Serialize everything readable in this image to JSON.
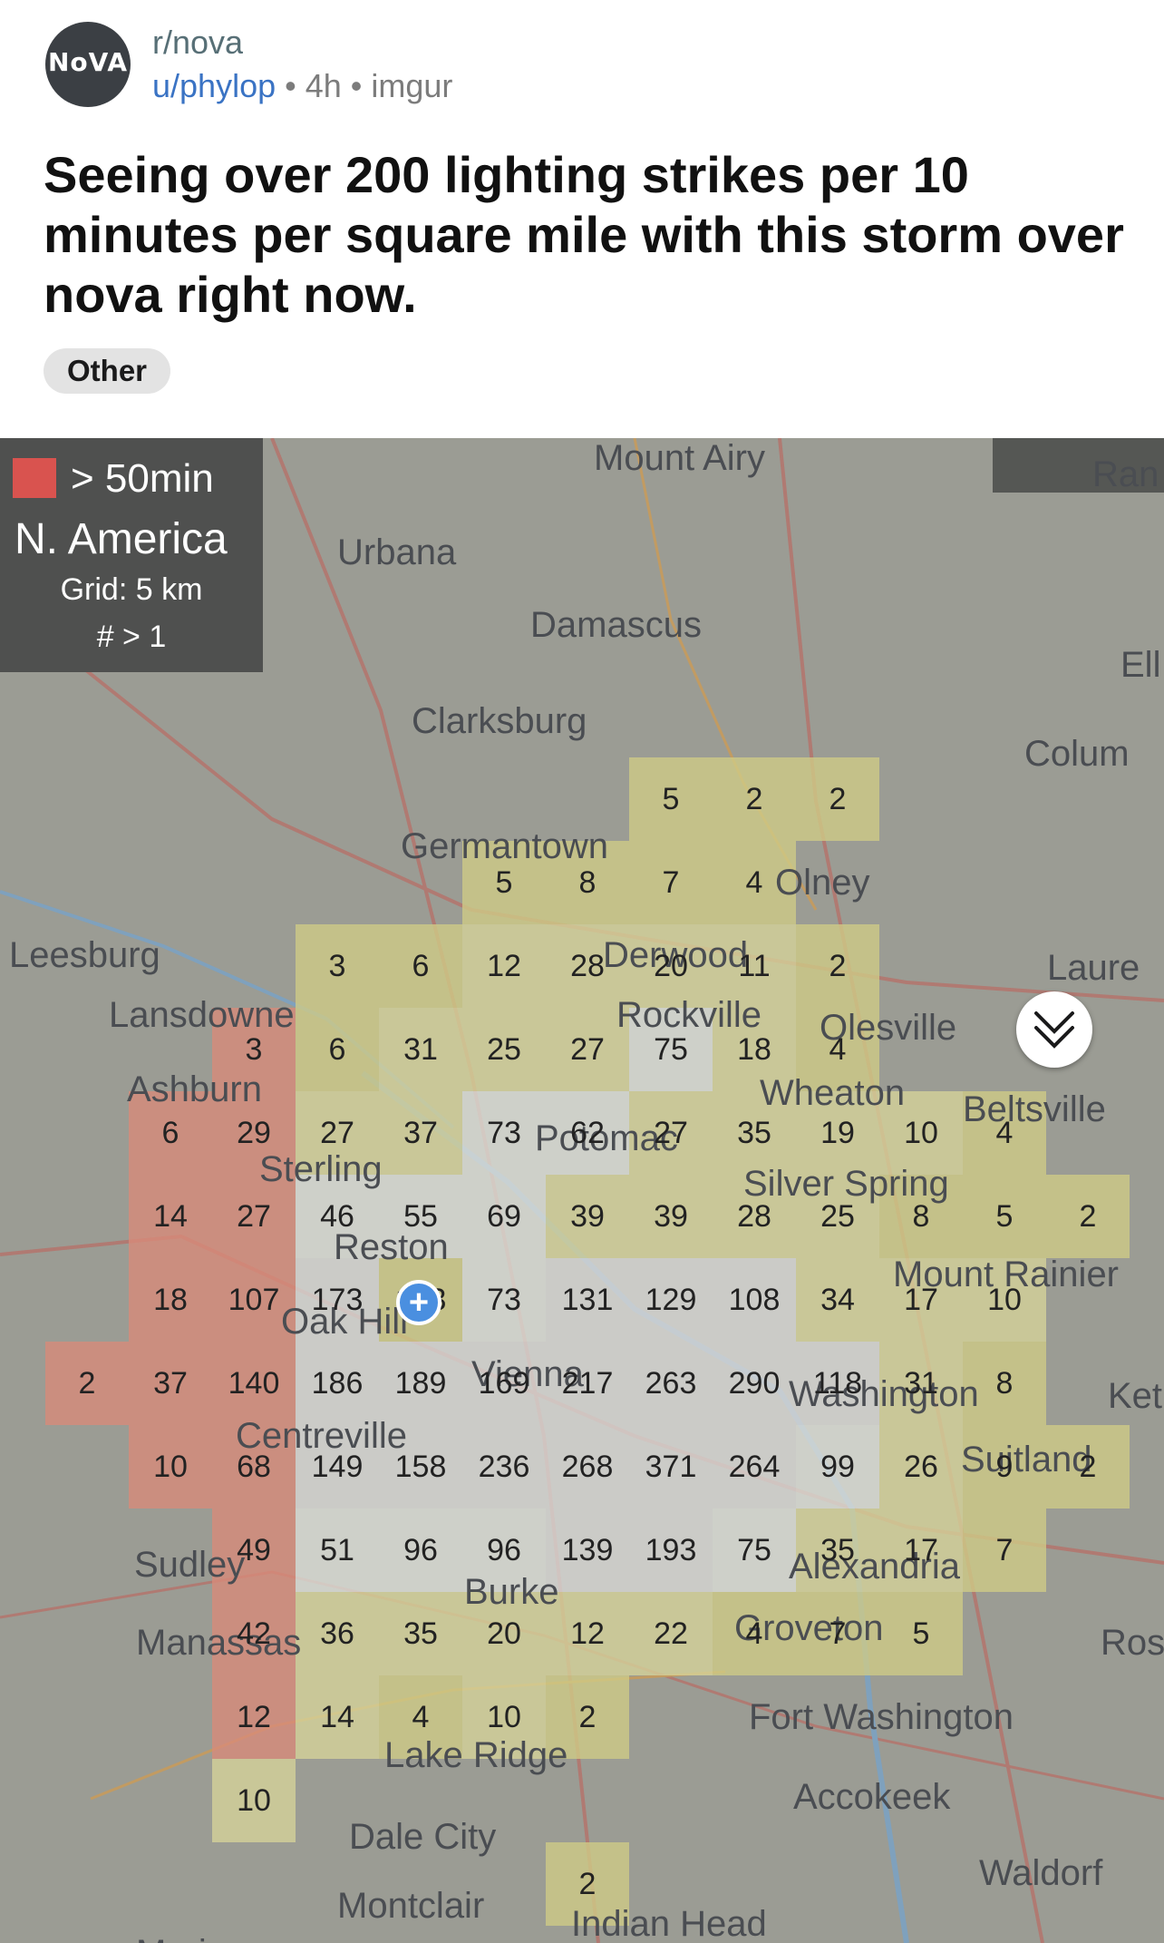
{
  "post": {
    "avatar_text": "NoVA",
    "subreddit": "r/nova",
    "user": "u/phylop",
    "age": "4h",
    "source": "imgur",
    "separator": "•",
    "title": "Seeing over 200 lighting strikes per 10 minutes per square mile with this storm over nova right now.",
    "flair": "Other"
  },
  "map": {
    "legend": {
      "swatch_color": "#d9534f",
      "label": "> 50min",
      "region": "N. America",
      "grid": "Grid: 5 km",
      "threshold": "# > 1"
    },
    "places": [
      "Mount Airy",
      "Ran",
      "Urbana",
      "Damascus",
      "Ell",
      "Clarksburg",
      "Colum",
      "Germantown",
      "Olney",
      "Leesburg",
      "Derwood",
      "Laure",
      "Lansdowne",
      "Rockville",
      "Olesville",
      "Ashburn",
      "Wheaton",
      "Beltsville",
      "Sterling",
      "Potomac",
      "Silver Spring",
      "Reston",
      "Mount Rainier",
      "Oak Hill",
      "Vienna",
      "Washington",
      "Ket",
      "Centreville",
      "Suitland",
      "Sudley",
      "Alexandria",
      "Burke",
      "Manassas",
      "Groveton",
      "Ros",
      "Fort Washington",
      "Lake Ridge",
      "Accokeek",
      "Dale City",
      "Waldorf",
      "Montclair",
      "Indian Head",
      "Marine"
    ],
    "strike_rows": [
      [
        "5",
        "2",
        "2"
      ],
      [
        "5",
        "8",
        "7",
        "4"
      ],
      [
        "3",
        "6",
        "12",
        "28",
        "20",
        "11",
        "2"
      ],
      [
        "3",
        "6",
        "31",
        "25",
        "27",
        "75",
        "18",
        "4"
      ],
      [
        "6",
        "29",
        "27",
        "37",
        "73",
        "62",
        "27",
        "35",
        "19",
        "10",
        "4"
      ],
      [
        "14",
        "27",
        "46",
        "55",
        "69",
        "39",
        "39",
        "28",
        "25",
        "8",
        "5",
        "2"
      ],
      [
        "18",
        "107",
        "173",
        "1?3",
        "73",
        "131",
        "129",
        "108",
        "34",
        "17",
        "10"
      ],
      [
        "2",
        "37",
        "140",
        "186",
        "189",
        "169",
        "217",
        "263",
        "290",
        "118",
        "31",
        "8"
      ],
      [
        "10",
        "68",
        "149",
        "158",
        "236",
        "268",
        "371",
        "264",
        "99",
        "26",
        "9",
        "2"
      ],
      [
        "49",
        "51",
        "96",
        "96",
        "139",
        "193",
        "75",
        "35",
        "17",
        "7"
      ],
      [
        "42",
        "36",
        "35",
        "20",
        "12",
        "22",
        "4",
        "7",
        "5"
      ],
      [
        "12",
        "14",
        "4",
        "10",
        "2"
      ],
      [
        "10"
      ],
      [
        "2"
      ]
    ]
  },
  "icons": {
    "collapse": "double-chevron-down-icon",
    "location": "location-pin-icon"
  }
}
